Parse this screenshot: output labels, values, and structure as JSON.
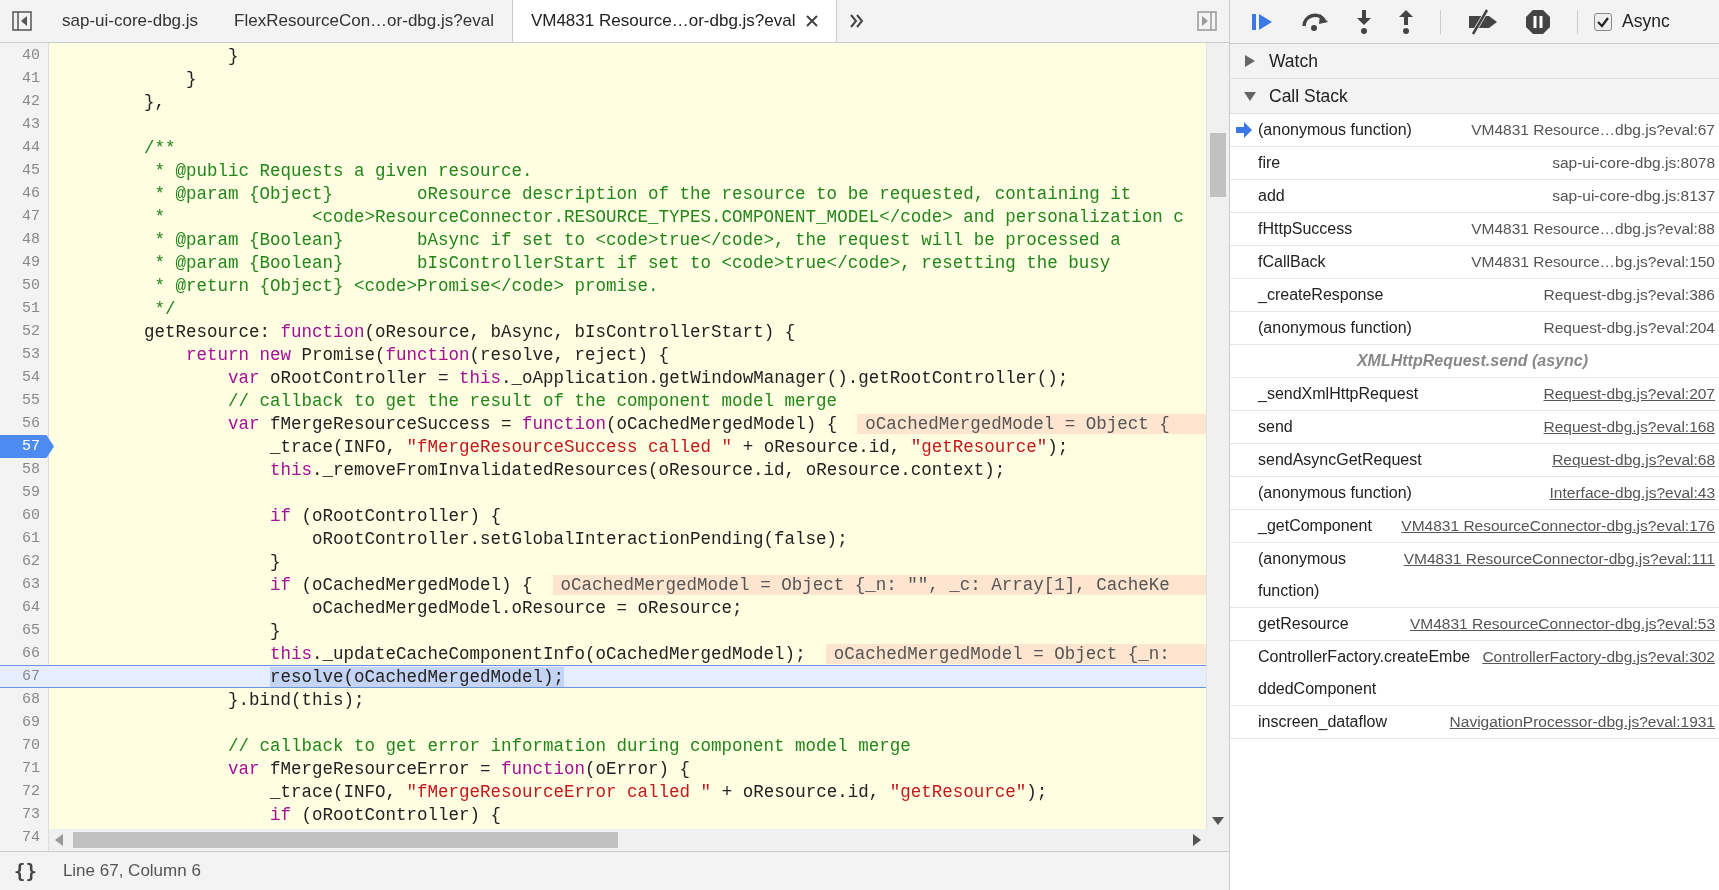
{
  "tabs": [
    {
      "label": "sap-ui-core-dbg.js",
      "selected": false
    },
    {
      "label": "FlexResourceCon…or-dbg.js?eval",
      "selected": false
    },
    {
      "label": "VM4831 Resource…or-dbg.js?eval",
      "selected": true
    }
  ],
  "code": {
    "lines": [
      {
        "number": "40",
        "breakpoint": false,
        "current": false,
        "segments": [
          {
            "kind": "plain",
            "text": "                }"
          }
        ]
      },
      {
        "number": "41",
        "breakpoint": false,
        "current": false,
        "segments": [
          {
            "kind": "plain",
            "text": "            }"
          }
        ]
      },
      {
        "number": "42",
        "breakpoint": false,
        "current": false,
        "segments": [
          {
            "kind": "plain",
            "text": "        },"
          }
        ]
      },
      {
        "number": "43",
        "breakpoint": false,
        "current": false
      },
      {
        "number": "44",
        "breakpoint": false,
        "current": false,
        "segments": [
          {
            "kind": "comment",
            "text": "        /**"
          }
        ]
      },
      {
        "number": "45",
        "breakpoint": false,
        "current": false,
        "segments": [
          {
            "kind": "comment",
            "text": "         * @public Requests a given resource."
          }
        ]
      },
      {
        "number": "46",
        "breakpoint": false,
        "current": false,
        "segments": [
          {
            "kind": "comment",
            "text": "         * @param {Object}        oResource description of the resource to be requested, containing it"
          }
        ]
      },
      {
        "number": "47",
        "breakpoint": false,
        "current": false,
        "segments": [
          {
            "kind": "comment",
            "text": "         *              <code>ResourceConnector.RESOURCE_TYPES.COMPONENT_MODEL</code> and personalization c"
          }
        ]
      },
      {
        "number": "48",
        "breakpoint": false,
        "current": false,
        "segments": [
          {
            "kind": "comment",
            "text": "         * @param {Boolean}       bAsync if set to <code>true</code>, the request will be processed a"
          }
        ]
      },
      {
        "number": "49",
        "breakpoint": false,
        "current": false,
        "segments": [
          {
            "kind": "comment",
            "text": "         * @param {Boolean}       bIsControllerStart if set to <code>true</code>, resetting the busy"
          }
        ]
      },
      {
        "number": "50",
        "breakpoint": false,
        "current": false,
        "segments": [
          {
            "kind": "comment",
            "text": "         * @return {Object} <code>Promise</code> promise."
          }
        ]
      },
      {
        "number": "51",
        "breakpoint": false,
        "current": false,
        "segments": [
          {
            "kind": "comment",
            "text": "         */"
          }
        ]
      },
      {
        "number": "52",
        "breakpoint": false,
        "current": false,
        "segments": [
          {
            "kind": "plain",
            "text": "        getResource: "
          },
          {
            "kind": "keyword",
            "text": "function"
          },
          {
            "kind": "plain",
            "text": "(oResource, bAsync, bIsControllerStart) {"
          }
        ]
      },
      {
        "number": "53",
        "breakpoint": false,
        "current": false,
        "segments": [
          {
            "kind": "keyword",
            "text": "            return new"
          },
          {
            "kind": "plain",
            "text": " Promise("
          },
          {
            "kind": "keyword",
            "text": "function"
          },
          {
            "kind": "plain",
            "text": "(resolve, reject) {"
          }
        ]
      },
      {
        "number": "54",
        "breakpoint": false,
        "current": false,
        "segments": [
          {
            "kind": "keyword",
            "text": "                var"
          },
          {
            "kind": "plain",
            "text": " oRootController = "
          },
          {
            "kind": "keyword",
            "text": "this"
          },
          {
            "kind": "plain",
            "text": "._oApplication.getWindowManager().getRootController();"
          }
        ]
      },
      {
        "number": "55",
        "breakpoint": false,
        "current": false,
        "segments": [
          {
            "kind": "comment",
            "text": "                // callback to get the result of the component model merge"
          }
        ]
      },
      {
        "number": "56",
        "breakpoint": false,
        "current": false,
        "segments": [
          {
            "kind": "keyword",
            "text": "                var"
          },
          {
            "kind": "plain",
            "text": " fMergeResourceSuccess = "
          },
          {
            "kind": "keyword",
            "text": "function"
          },
          {
            "kind": "plain",
            "text": "(oCachedMergedModel) {"
          }
        ],
        "inline_value": "oCachedMergedModel = Object {"
      },
      {
        "number": "57",
        "breakpoint": true,
        "current": false,
        "segments": [
          {
            "kind": "plain",
            "text": "                    _trace(INFO, "
          },
          {
            "kind": "string",
            "text": "\"fMergeResourceSuccess called \""
          },
          {
            "kind": "plain",
            "text": " + oResource.id, "
          },
          {
            "kind": "string",
            "text": "\"getResource\""
          },
          {
            "kind": "plain",
            "text": ");"
          }
        ]
      },
      {
        "number": "58",
        "breakpoint": false,
        "current": false,
        "segments": [
          {
            "kind": "keyword",
            "text": "                    this"
          },
          {
            "kind": "plain",
            "text": "._removeFromInvalidatedResources(oResource.id, oResource.context);"
          }
        ]
      },
      {
        "number": "59",
        "breakpoint": false,
        "current": false
      },
      {
        "number": "60",
        "breakpoint": false,
        "current": false,
        "segments": [
          {
            "kind": "keyword",
            "text": "                    if"
          },
          {
            "kind": "plain",
            "text": " (oRootController) {"
          }
        ]
      },
      {
        "number": "61",
        "breakpoint": false,
        "current": false,
        "segments": [
          {
            "kind": "plain",
            "text": "                        oRootController.setGlobalInteractionPending(false);"
          }
        ]
      },
      {
        "number": "62",
        "breakpoint": false,
        "current": false,
        "segments": [
          {
            "kind": "plain",
            "text": "                    }"
          }
        ]
      },
      {
        "number": "63",
        "breakpoint": false,
        "current": false,
        "segments": [
          {
            "kind": "keyword",
            "text": "                    if"
          },
          {
            "kind": "plain",
            "text": " (oCachedMergedModel) {"
          }
        ],
        "inline_value": "oCachedMergedModel = Object {_n: \"\", _c: Array[1], CacheKe"
      },
      {
        "number": "64",
        "breakpoint": false,
        "current": false,
        "segments": [
          {
            "kind": "plain",
            "text": "                        oCachedMergedModel.oResource = oResource;"
          }
        ]
      },
      {
        "number": "65",
        "breakpoint": false,
        "current": false,
        "segments": [
          {
            "kind": "plain",
            "text": "                    }"
          }
        ]
      },
      {
        "number": "66",
        "breakpoint": false,
        "current": false,
        "segments": [
          {
            "kind": "keyword",
            "text": "                    this"
          },
          {
            "kind": "plain",
            "text": "._updateCacheComponentInfo(oCachedMergedModel);"
          }
        ],
        "inline_value": "oCachedMergedModel = Object {_n:"
      },
      {
        "number": "67",
        "breakpoint": false,
        "current": true,
        "segments": [
          {
            "kind": "selection",
            "text": "                    resolve(oCachedMergedModel);"
          }
        ]
      },
      {
        "number": "68",
        "breakpoint": false,
        "current": false,
        "segments": [
          {
            "kind": "plain",
            "text": "                }.bind(this);"
          }
        ]
      },
      {
        "number": "69",
        "breakpoint": false,
        "current": false
      },
      {
        "number": "70",
        "breakpoint": false,
        "current": false,
        "segments": [
          {
            "kind": "comment",
            "text": "                // callback to get error information during component model merge"
          }
        ]
      },
      {
        "number": "71",
        "breakpoint": false,
        "current": false,
        "segments": [
          {
            "kind": "keyword",
            "text": "                var"
          },
          {
            "kind": "plain",
            "text": " fMergeResourceError = "
          },
          {
            "kind": "keyword",
            "text": "function"
          },
          {
            "kind": "plain",
            "text": "(oError) {"
          }
        ]
      },
      {
        "number": "72",
        "breakpoint": false,
        "current": false,
        "segments": [
          {
            "kind": "plain",
            "text": "                    _trace(INFO, "
          },
          {
            "kind": "string",
            "text": "\"fMergeResourceError called \""
          },
          {
            "kind": "plain",
            "text": " + oResource.id, "
          },
          {
            "kind": "string",
            "text": "\"getResource\""
          },
          {
            "kind": "plain",
            "text": ");"
          }
        ]
      },
      {
        "number": "73",
        "breakpoint": false,
        "current": false,
        "segments": [
          {
            "kind": "keyword",
            "text": "                    if"
          },
          {
            "kind": "plain",
            "text": " (oRootController) {"
          }
        ]
      },
      {
        "number": "74",
        "breakpoint": false,
        "current": false
      }
    ]
  },
  "status_bar": {
    "pretty_print": "{}",
    "position": "Line 67, Column 6"
  },
  "debugger": {
    "async": {
      "label": "Async",
      "checked": true
    },
    "sections": [
      {
        "title": "Watch",
        "expanded": false
      },
      {
        "title": "Call Stack",
        "expanded": true
      }
    ],
    "call_stack": [
      {
        "kind": "frame",
        "name": "(anonymous function)",
        "location": "VM4831 Resource…dbg.js?eval:67",
        "linked": false,
        "current": true
      },
      {
        "kind": "frame",
        "name": "fire",
        "location": "sap-ui-core-dbg.js:8078",
        "linked": false,
        "current": false
      },
      {
        "kind": "frame",
        "name": "add",
        "location": "sap-ui-core-dbg.js:8137",
        "linked": false,
        "current": false
      },
      {
        "kind": "frame",
        "name": "fHttpSuccess",
        "location": "VM4831 Resource…dbg.js?eval:88",
        "linked": false,
        "current": false
      },
      {
        "kind": "frame",
        "name": "fCallBack",
        "location": "VM4831 Resource…bg.js?eval:150",
        "linked": false,
        "current": false
      },
      {
        "kind": "frame",
        "name": "_createResponse",
        "location": "Request-dbg.js?eval:386",
        "linked": false,
        "current": false
      },
      {
        "kind": "frame",
        "name": "(anonymous function)",
        "location": "Request-dbg.js?eval:204",
        "linked": false,
        "current": false
      },
      {
        "kind": "async",
        "name": "XMLHttpRequest.send (async)"
      },
      {
        "kind": "frame",
        "name": "_sendXmlHttpRequest",
        "location": "Request-dbg.js?eval:207",
        "linked": true,
        "current": false
      },
      {
        "kind": "frame",
        "name": "send",
        "location": "Request-dbg.js?eval:168",
        "linked": true,
        "current": false
      },
      {
        "kind": "frame",
        "name": "sendAsyncGetRequest",
        "location": "Request-dbg.js?eval:68",
        "linked": true,
        "current": false
      },
      {
        "kind": "frame",
        "name": "(anonymous function)",
        "location": "Interface-dbg.js?eval:43",
        "linked": true,
        "current": false
      },
      {
        "kind": "frame",
        "name": "_getComponent",
        "location": "VM4831 ResourceConnector-dbg.js?eval:176",
        "linked": true,
        "current": false
      },
      {
        "kind": "frame",
        "name": "(anonymous function)",
        "location": "VM4831 ResourceConnector-dbg.js?eval:111",
        "linked": true,
        "current": false
      },
      {
        "kind": "frame",
        "name": "getResource",
        "location": "VM4831 ResourceConnector-dbg.js?eval:53",
        "linked": true,
        "current": false
      },
      {
        "kind": "frame",
        "name": "ControllerFactory.createEmbeddedComponent",
        "location": "ControllerFactory-dbg.js?eval:302",
        "linked": true,
        "current": false
      },
      {
        "kind": "frame",
        "name": "inscreen_dataflow",
        "location": "NavigationProcessor-dbg.js?eval:1931",
        "linked": true,
        "current": false
      }
    ]
  }
}
